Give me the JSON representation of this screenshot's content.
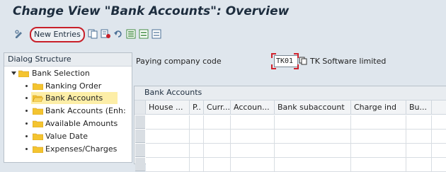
{
  "title": "Change View \"Bank Accounts\": Overview",
  "toolbar": {
    "new_entries_label": "New Entries",
    "icons": [
      "display-change-icon",
      "copy-icon",
      "delete-icon",
      "undo-icon",
      "select-all-icon",
      "select-block-icon",
      "deselect-all-icon"
    ]
  },
  "dialog_structure": {
    "header": "Dialog Structure",
    "root": "Bank Selection",
    "items": [
      {
        "label": "Ranking Order",
        "selected": false
      },
      {
        "label": "Bank Accounts",
        "selected": true
      },
      {
        "label": "Bank Accounts (Enh:",
        "selected": false
      },
      {
        "label": "Available Amounts",
        "selected": false
      },
      {
        "label": "Value Date",
        "selected": false
      },
      {
        "label": "Expenses/Charges",
        "selected": false
      }
    ]
  },
  "header_fields": {
    "paying_company_code_label": "Paying company code",
    "paying_company_code_value": "TK01",
    "company_name": "TK Software limited"
  },
  "table": {
    "title": "Bank Accounts",
    "columns": [
      "House ...",
      "P..",
      "Curr...",
      "Accoun...",
      "Bank subaccount",
      "Charge ind",
      "Bu..."
    ],
    "rows": [
      [],
      [],
      [],
      []
    ]
  },
  "colors": {
    "accent_red": "#c8202a",
    "folder_yellow": "#f4c430",
    "selection_yellow": "#fdeea7",
    "background": "#dfe6ed"
  }
}
